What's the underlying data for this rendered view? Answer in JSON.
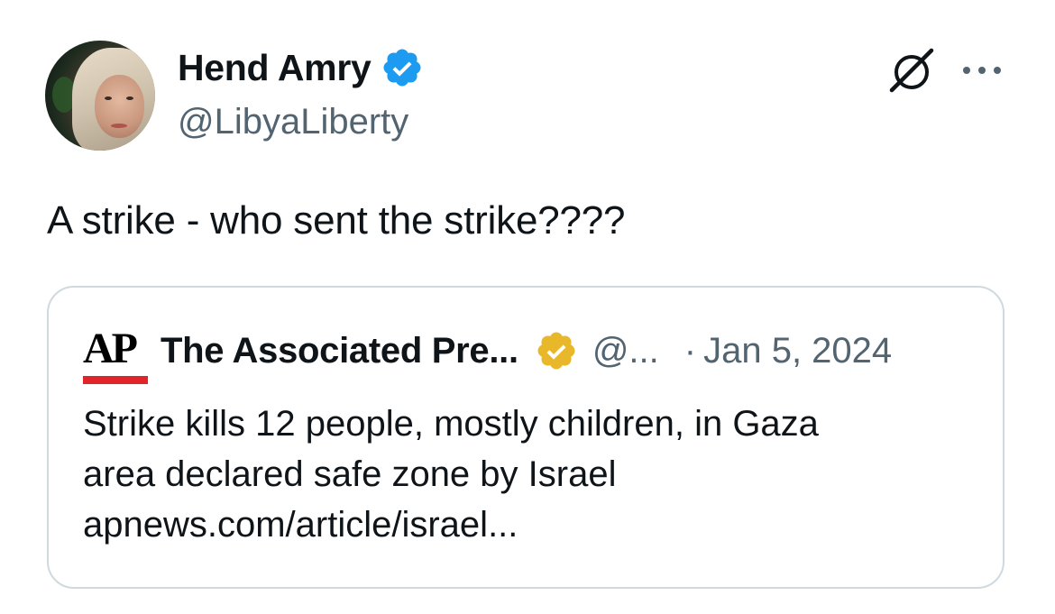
{
  "author": {
    "display_name": "Hend Amry",
    "handle": "@LibyaLiberty",
    "verified": true,
    "badge_color": "#1d9bf0"
  },
  "tweet": {
    "text": "A strike - who sent the strike????"
  },
  "icons": {
    "grok": "grok-icon",
    "more": "more-options-icon"
  },
  "quoted_tweet": {
    "logo_text": "AP",
    "logo_bar_color": "#e0242a",
    "display_name": "The Associated Pre...",
    "badge_color": "#e8b82a",
    "handle": "@...",
    "separator": "·",
    "date": "Jan 5, 2024",
    "body_lines": [
      "Strike kills 12 people, mostly children, in Gaza",
      "area declared safe zone by Israel",
      "apnews.com/article/israel..."
    ]
  }
}
